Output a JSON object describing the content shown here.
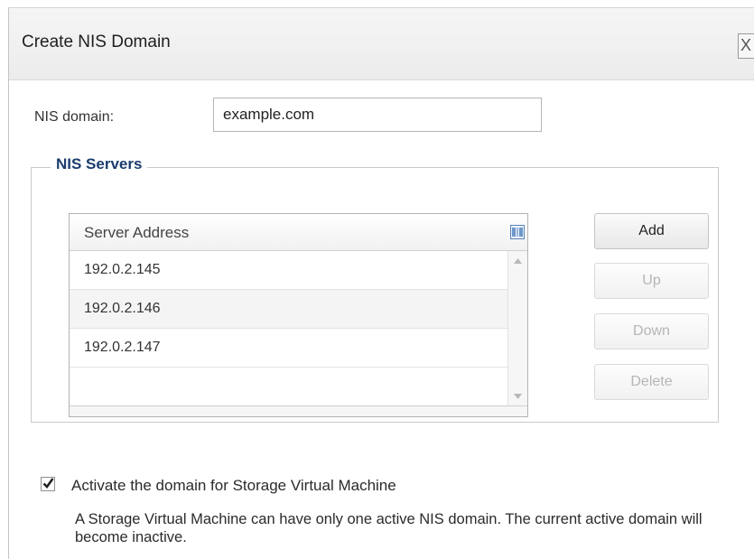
{
  "dialog": {
    "title": "Create NIS Domain",
    "close_label": "X"
  },
  "form": {
    "domain_label": "NIS domain:",
    "domain_value": "example.com"
  },
  "servers": {
    "legend": "NIS Servers",
    "column_header": "Server Address",
    "rows": [
      "192.0.2.145",
      "192.0.2.146",
      "192.0.2.147",
      ""
    ]
  },
  "buttons": {
    "add": "Add",
    "up": "Up",
    "down": "Down",
    "delete": "Delete"
  },
  "activate": {
    "checked": true,
    "label": "Activate the domain for Storage Virtual Machine",
    "note": "A Storage Virtual Machine can have only one active NIS domain. The current active domain will become inactive."
  },
  "icons": {
    "close": "close-icon",
    "columns_menu": "column-menu-icon",
    "scroll_up": "scroll-up-icon",
    "scroll_down": "scroll-down-icon",
    "checkbox_mark": "checkmark-icon"
  },
  "colors": {
    "legend": "#1b3d6d",
    "disabled_text": "#b5b5b5"
  }
}
